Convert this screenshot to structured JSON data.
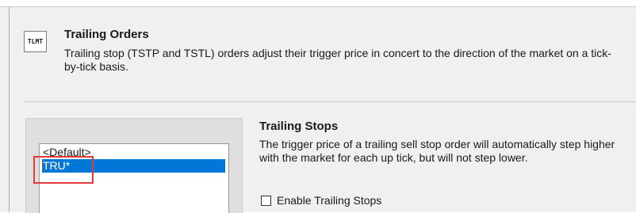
{
  "header": {
    "icon_text": "TLMT",
    "title": "Trailing Orders",
    "description": "Trailing stop (TSTP and TSTL) orders adjust their trigger price in concert to the direction of the market on a tick-by-tick basis."
  },
  "list": {
    "items": [
      {
        "label": "<Default>",
        "selected": false
      },
      {
        "label": "TRU*",
        "selected": true
      }
    ]
  },
  "section": {
    "title": "Trailing Stops",
    "description": "The trigger price of a trailing sell stop order will automatically step higher with the market for each up tick, but will not step lower.",
    "checkbox_label": "Enable Trailing Stops",
    "checkbox_checked": false
  },
  "colors": {
    "selection": "#0078d7",
    "highlight": "#e03a3a",
    "panel": "#f0f0f0"
  }
}
